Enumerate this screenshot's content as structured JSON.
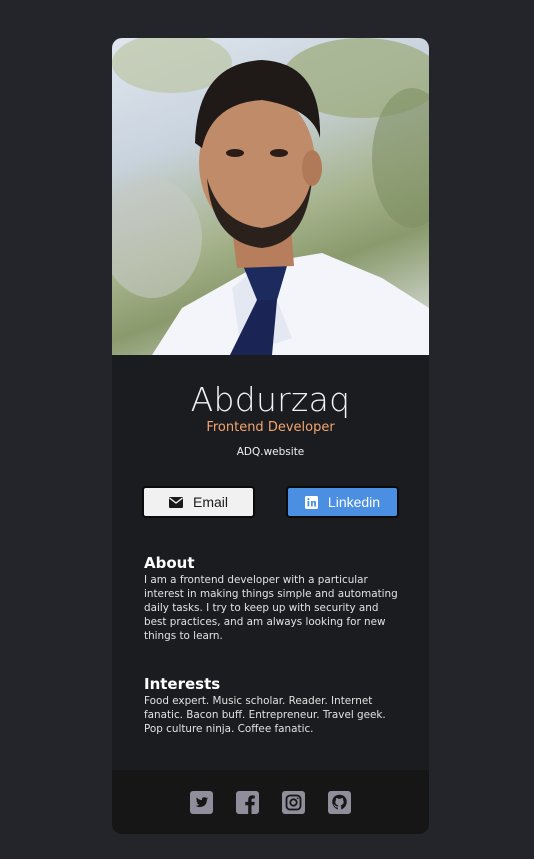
{
  "profile": {
    "name": "Abdurzaq",
    "role": "Frontend Developer",
    "website": "ADQ.website"
  },
  "buttons": {
    "email_label": "Email",
    "linkedin_label": "Linkedin"
  },
  "about": {
    "title": "About",
    "body": "I am a frontend developer with a particular interest in making things simple and automating daily tasks. I try to keep up with security and best practices, and am always looking for new things to learn."
  },
  "interests": {
    "title": "Interests",
    "body": "Food expert. Music scholar. Reader. Internet fanatic. Bacon buff. Entrepreneur. Travel geek. Pop culture ninja. Coffee fanatic."
  },
  "social_icons": [
    "twitter-icon",
    "facebook-icon",
    "instagram-icon",
    "github-icon"
  ],
  "colors": {
    "page_background": "#23252b",
    "card_background": "#1b1c20",
    "footer_background": "#161617",
    "role_accent": "#f3a56f",
    "linkedin_blue": "#4a8fe1",
    "email_button": "#f1f1f1",
    "social_icon": "#918e9b"
  }
}
